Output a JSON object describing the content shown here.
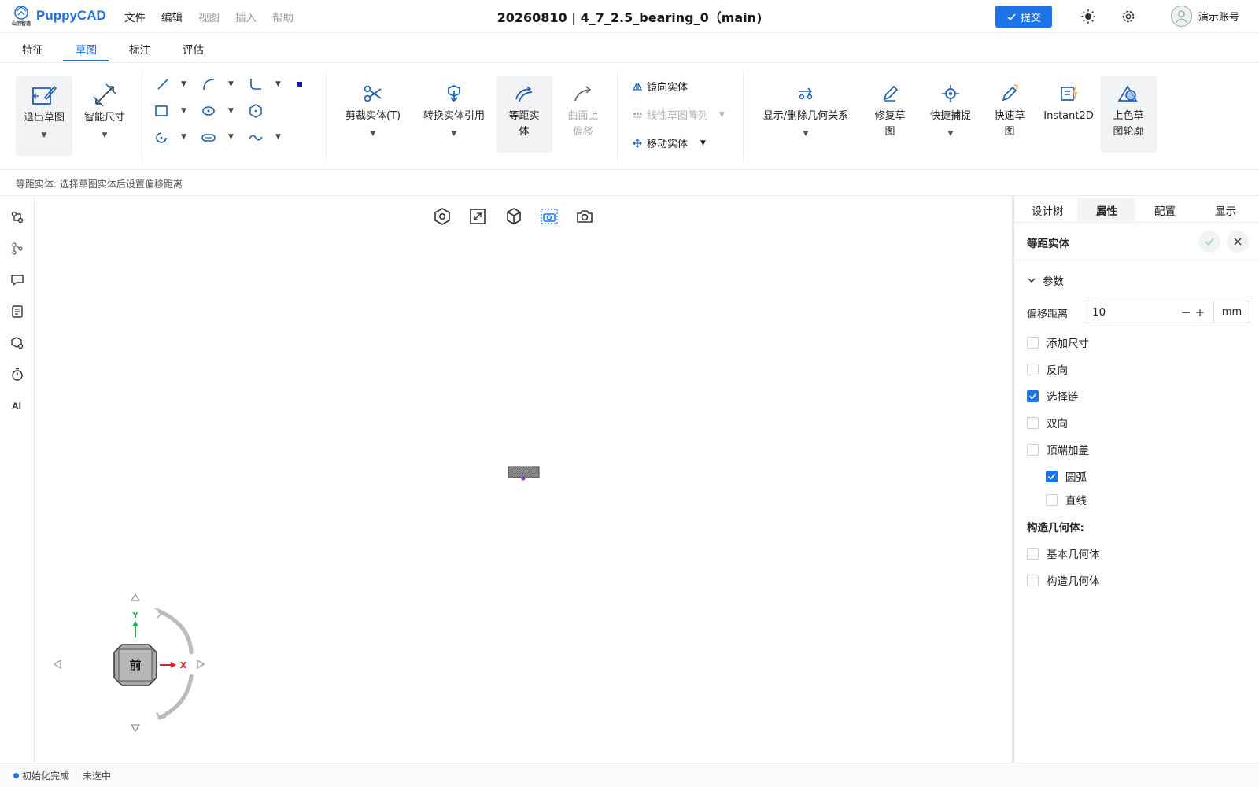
{
  "app": {
    "name": "PuppyCAD",
    "logo_caption": "山羽智造"
  },
  "menus": [
    {
      "label": "文件",
      "enabled": true
    },
    {
      "label": "编辑",
      "enabled": true
    },
    {
      "label": "视图",
      "enabled": false
    },
    {
      "label": "插入",
      "enabled": false
    },
    {
      "label": "帮助",
      "enabled": false
    }
  ],
  "document": {
    "title": "20260810 | 4_7_2.5_bearing_0（main)"
  },
  "header": {
    "submit_label": "提交",
    "user_name": "演示账号"
  },
  "tabs": {
    "items": [
      "特征",
      "草图",
      "标注",
      "评估"
    ],
    "active": "草图"
  },
  "ribbon": {
    "exit_sketch": "退出草图",
    "smart_dimension": "智能尺寸",
    "trim": "剪裁实体(T)",
    "convert": "转换实体引用",
    "offset_line1": "等距实",
    "offset_line2": "体",
    "surface_offset_line1": "曲面上",
    "surface_offset_line2": "偏移",
    "mirror": "镜向实体",
    "linear_pattern": "线性草图阵列",
    "move": "移动实体",
    "relations": "显示/删除几何关系",
    "repair_line1": "修复草",
    "repair_line2": "图",
    "quick_snap": "快捷捕捉",
    "quick_sketch_line1": "快速草",
    "quick_sketch_line2": "图",
    "instant2d": "Instant2D",
    "shade_line1": "上色草",
    "shade_line2": "图轮廓"
  },
  "hint": "等距实体: 选择草图实体后设置偏移距离",
  "nav_cube": {
    "face_label": "前",
    "x_label": "X",
    "y_label": "Y"
  },
  "panel": {
    "tabs": [
      "设计树",
      "属性",
      "配置",
      "显示"
    ],
    "active_tab": "属性",
    "feature_title": "等距实体",
    "params_label": "参数",
    "offset_label": "偏移距离",
    "offset_value": "10",
    "offset_unit": "mm",
    "options": [
      {
        "label": "添加尺寸",
        "checked": false
      },
      {
        "label": "反向",
        "checked": false
      },
      {
        "label": "选择链",
        "checked": true
      },
      {
        "label": "双向",
        "checked": false
      },
      {
        "label": "顶端加盖",
        "checked": false
      },
      {
        "label": "圆弧",
        "checked": true
      },
      {
        "label": "直线",
        "checked": false
      }
    ],
    "construct_label": "构造几何体:",
    "construct_options": [
      {
        "label": "基本几何体",
        "checked": false
      },
      {
        "label": "构造几何体",
        "checked": false
      }
    ]
  },
  "status": {
    "state": "初始化完成",
    "selection": "未选中"
  },
  "colors": {
    "accent": "#1e73e8",
    "brand": "#1e6fd9"
  }
}
